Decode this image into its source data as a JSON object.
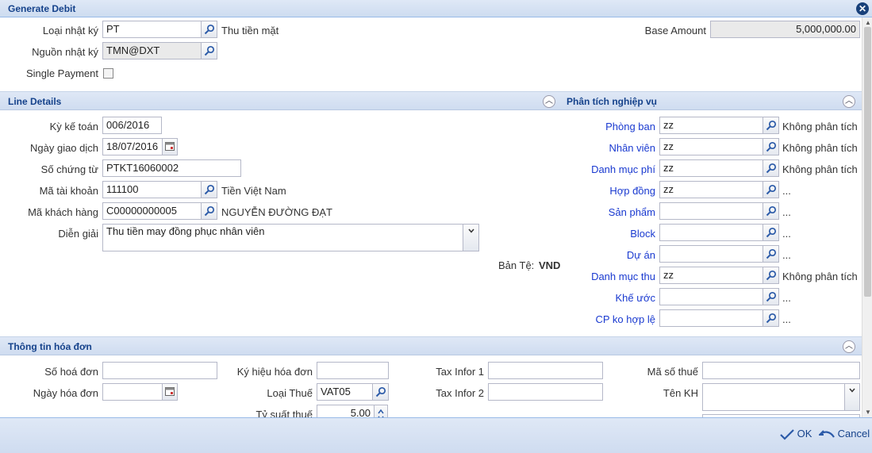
{
  "window": {
    "title": "Generate Debit"
  },
  "header": {
    "loai_nhat_ky": {
      "label": "Loại nhật ký",
      "value": "PT",
      "desc": "Thu tiền mặt"
    },
    "nguon_nhat_ky": {
      "label": "Nguồn nhật ký",
      "value": "TMN@DXT"
    },
    "single_payment": {
      "label": "Single Payment",
      "checked": false
    },
    "base_amount": {
      "label": "Base Amount",
      "value": "5,000,000.00"
    }
  },
  "line_details": {
    "title": "Line Details",
    "ky_ke_toan": {
      "label": "Kỳ kế toán",
      "value": "006/2016"
    },
    "ngay_giao_dich": {
      "label": "Ngày giao dịch",
      "value": "18/07/2016"
    },
    "so_chung_tu": {
      "label": "Số chứng từ",
      "value": "PTKT16060002"
    },
    "ma_tai_khoan": {
      "label": "Mã tài khoản",
      "value": "111100",
      "desc": "Tiền Việt Nam"
    },
    "ma_khach_hang": {
      "label": "Mã khách hàng",
      "value": "C00000000005",
      "desc": "NGUYỄN ĐƯỜNG ĐẠT"
    },
    "dien_giai": {
      "label": "Diễn giải",
      "value": "Thu tiền may đồng phục nhân viên"
    },
    "ban_te": {
      "label": "Bản Tệ:",
      "value": "VND"
    }
  },
  "analysis": {
    "title": "Phân tích nghiệp vụ",
    "rows": [
      {
        "label": "Phòng ban",
        "value": "zz",
        "desc": "Không phân tích"
      },
      {
        "label": "Nhân viên",
        "value": "zz",
        "desc": "Không phân tích"
      },
      {
        "label": "Danh mục phí",
        "value": "zz",
        "desc": "Không phân tích"
      },
      {
        "label": "Hợp đồng",
        "value": "zz",
        "desc": "..."
      },
      {
        "label": "Sản phẩm",
        "value": "",
        "desc": "..."
      },
      {
        "label": "Block",
        "value": "",
        "desc": "..."
      },
      {
        "label": "Dự án",
        "value": "",
        "desc": "..."
      },
      {
        "label": "Danh mục thu",
        "value": "zz",
        "desc": "Không phân tích"
      },
      {
        "label": "Khế ước",
        "value": "",
        "desc": "..."
      },
      {
        "label": "CP ko hợp lệ",
        "value": "",
        "desc": "..."
      }
    ]
  },
  "invoice": {
    "title": "Thông tin hóa đơn",
    "so_hoa_don": {
      "label": "Số hoá đơn",
      "value": ""
    },
    "ngay_hoa_don": {
      "label": "Ngày hóa đơn",
      "value": ""
    },
    "ky_hieu_hoa_don": {
      "label": "Ký hiệu hóa đơn",
      "value": ""
    },
    "loai_thue": {
      "label": "Loại Thuế",
      "value": "VAT05"
    },
    "ty_suat_thue": {
      "label": "Tỷ suất thuế",
      "value": "5.00"
    },
    "tax_infor_1": {
      "label": "Tax Infor 1",
      "value": ""
    },
    "tax_infor_2": {
      "label": "Tax Infor 2",
      "value": ""
    },
    "ma_so_thue": {
      "label": "Mã số thuế",
      "value": ""
    },
    "ten_kh": {
      "label": "Tên KH",
      "value": ""
    }
  },
  "footer": {
    "ok_label": "OK",
    "cancel_label": "Cancel"
  }
}
